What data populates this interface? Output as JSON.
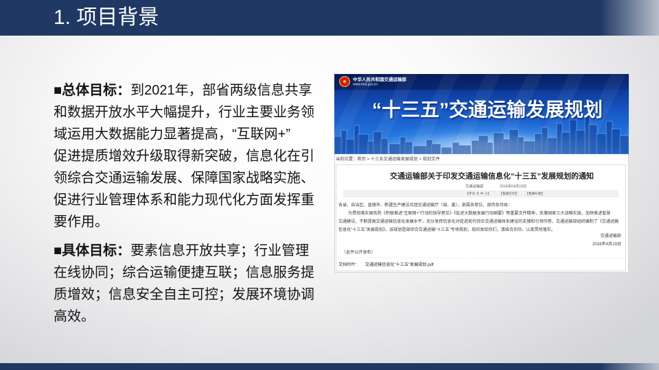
{
  "theme": {
    "navy": "#1f3864"
  },
  "slide": {
    "title": "1. 项目背景"
  },
  "overall_goal": {
    "bullet": "■",
    "label": "总体目标：",
    "lines": [
      "到2021年，部省两级信息共享",
      "和数据开放水平大幅提升，行业主要业务领",
      "域运用大数据能力显著提高，“互联网+”",
      "促进提质增效升级取得新突破，信息化在引",
      "领综合交通运输发展、保障国家战略实施、",
      "促进行业管理体系和能力现代化方面发挥重",
      "要作用。"
    ]
  },
  "specific_goal": {
    "bullet": "■",
    "label": "具体目标：",
    "lines": [
      "要素信息开放共享；行业管理",
      "在线协同；综合运输便捷互联；信息服务提",
      "质增效；信息安全自主可控；发展环境协调",
      "高效。"
    ]
  },
  "webpage": {
    "banner": {
      "emblem_icon": "national-emblem-icon",
      "site_name": "中华人民共和国交通运输部",
      "site_url": "www.mot.gov.cn",
      "headline": "“十三五”交通运输发展规划"
    },
    "breadcrumb": "当前位置：首页 > 十三五交通运输发展规划 > 规划文件",
    "article": {
      "title": "交通运输部关于印发交通运输信息化“十三五”发展规划的通知",
      "source": "交通运输部",
      "date": "2016年04月19日",
      "toolbar": [
        "【字号 大 中 小】",
        "【我要打印】",
        "【我要纠错】"
      ],
      "body_lines": [
        "各省、自治区、直辖市、新疆生产建设兵团交通运输厅（局、委），部属各单位，部内各司局：",
        "为贯彻落实国务院《积极推进“互联网+”行动的指导意见》《促进大数据发展行动纲要》等重要文件精神，支撑国家三大战略实施，加快推进智慧",
        "交通建设，不断提高交通运输信息化发展水平，充分发挥信息化对促进现代综合交通运输体系建设的支撑和引领作用，交通运输部组织编制了《交通运输",
        "信息化“十三五”发展规划》。该规划是部综合交通运输“十三五”专项规划，现印发给你们，请结合实际，认真贯彻落实。"
      ],
      "signature": "交通运输部",
      "signature_date": "2016年4月19日",
      "note": "（此件公开发布）",
      "attachment_label": "文档附件：",
      "attachment_file": "交通运输信息化“十三五”发展规划.pdf"
    }
  }
}
